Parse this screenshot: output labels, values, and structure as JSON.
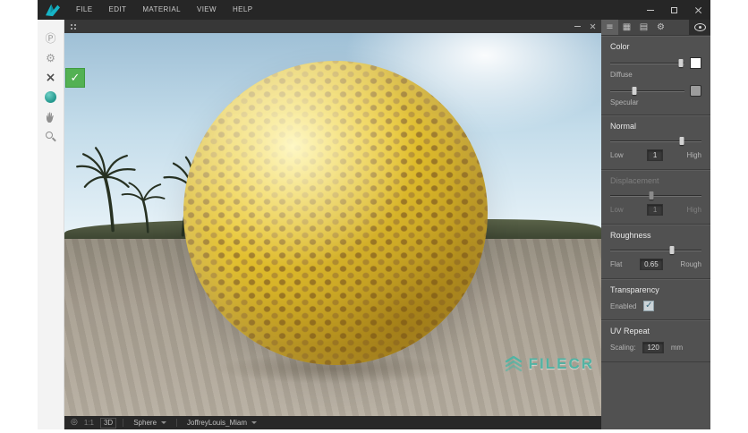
{
  "titlebar": {
    "menus": [
      "FILE",
      "EDIT",
      "MATERIAL",
      "VIEW",
      "HELP"
    ]
  },
  "icons": {
    "check": "✓",
    "pointer_tool": "Ⓟ",
    "gear": "⚙",
    "close_tool": "×",
    "bullseye": "◎",
    "hamburger": "≡",
    "grid": "▦",
    "grid_alt": "▤"
  },
  "viewport": {
    "status": {
      "zoom": "1:1",
      "mode": "3D",
      "shape": "Sphere",
      "material": "JoffreyLouis_Miam"
    },
    "watermark": "FILECR"
  },
  "panel": {
    "color": {
      "title": "Color",
      "diffuse": "Diffuse",
      "specular": "Specular"
    },
    "normal": {
      "title": "Normal",
      "low": "Low",
      "high": "High",
      "value": "1"
    },
    "displacement": {
      "title": "Displacement",
      "low": "Low",
      "high": "High",
      "value": "1"
    },
    "roughness": {
      "title": "Roughness",
      "flat": "Flat",
      "rough": "Rough",
      "value": "0.65"
    },
    "transparency": {
      "title": "Transparency",
      "enabled_label": "Enabled",
      "enabled": true
    },
    "uv": {
      "title": "UV Repeat",
      "scaling_label": "Scaling:",
      "value": "120",
      "unit": "mm"
    }
  },
  "colors": {
    "accent_teal": "#1db3c4",
    "badge_green": "#53b153",
    "sphere_yellow": "#eac72f",
    "watermark_teal": "#49b5a5",
    "panel_gray": "#515151"
  }
}
